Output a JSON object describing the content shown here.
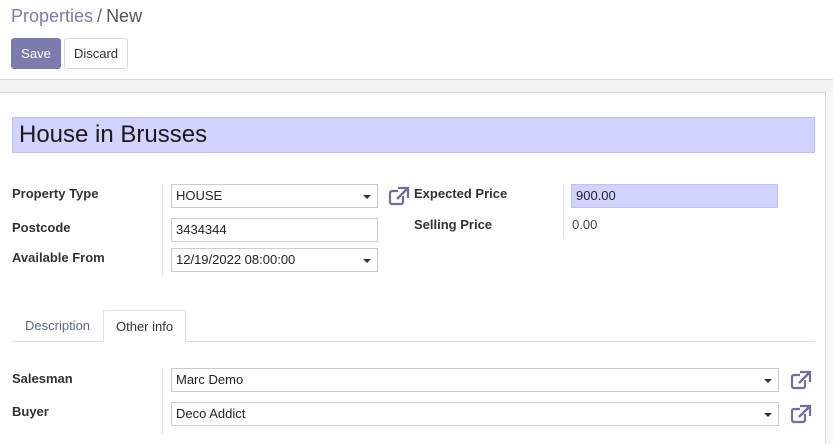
{
  "breadcrumb": {
    "parent": "Properties",
    "separator": "/",
    "current": "New"
  },
  "actions": {
    "save_label": "Save",
    "discard_label": "Discard"
  },
  "record": {
    "name": "House in Brusses"
  },
  "fields": {
    "property_type": {
      "label": "Property Type",
      "value": "HOUSE"
    },
    "postcode": {
      "label": "Postcode",
      "value": "3434344"
    },
    "available_from": {
      "label": "Available From",
      "value": "12/19/2022 08:00:00"
    },
    "expected_price": {
      "label": "Expected Price",
      "value": "900.00"
    },
    "selling_price": {
      "label": "Selling Price",
      "value": "0.00"
    }
  },
  "tabs": [
    {
      "label": "Description",
      "active": false
    },
    {
      "label": "Other info",
      "active": true
    }
  ],
  "other_info": {
    "salesman": {
      "label": "Salesman",
      "value": "Marc Demo"
    },
    "buyer": {
      "label": "Buyer",
      "value": "Deco Addict"
    }
  },
  "icons": {
    "external_link": "external-link-icon",
    "dropdown": "caret-down-icon"
  },
  "colors": {
    "accent": "#7c7bad",
    "highlight_field": "#d2d2ff"
  }
}
